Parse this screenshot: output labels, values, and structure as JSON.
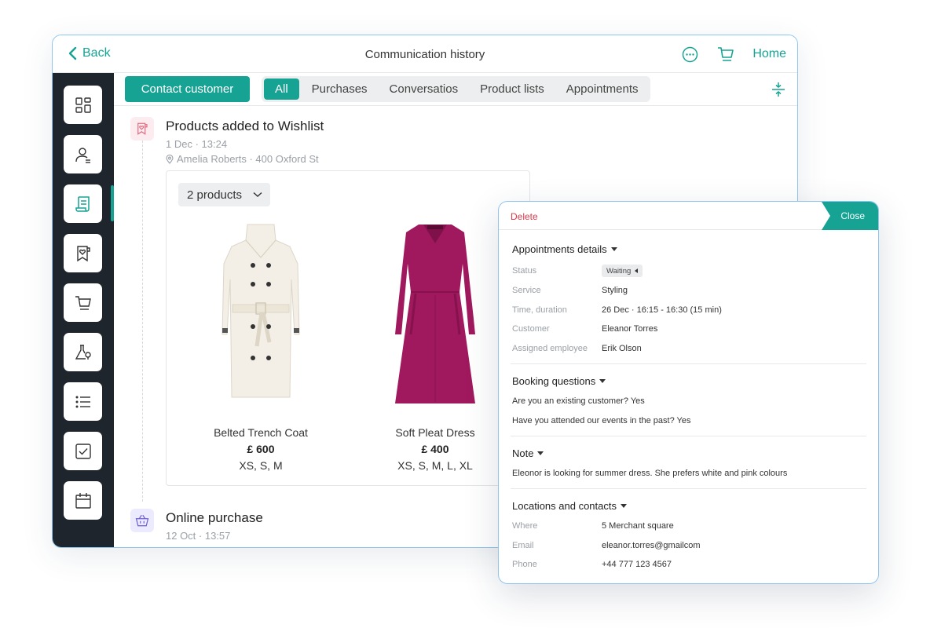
{
  "topbar": {
    "back_label": "Back",
    "title": "Communication history",
    "more_icon": "more-circle-icon",
    "cart_icon": "cart-icon",
    "home_label": "Home"
  },
  "sidebar": {
    "items": [
      {
        "icon": "dashboard-icon"
      },
      {
        "icon": "customer-profile-icon"
      },
      {
        "icon": "history-scroll-icon",
        "active": true
      },
      {
        "icon": "wishlist-bookmark-icon"
      },
      {
        "icon": "cart-icon"
      },
      {
        "icon": "lab-flask-icon"
      },
      {
        "icon": "list-icon"
      },
      {
        "icon": "checkbox-icon"
      },
      {
        "icon": "calendar-icon"
      }
    ]
  },
  "filters": {
    "contact_button": "Contact customer",
    "tabs": [
      "All",
      "Purchases",
      "Conversatios",
      "Product lists",
      "Appointments"
    ],
    "active_tab": "All"
  },
  "timeline": {
    "wishlist_event": {
      "title": "Products added to Wishlist",
      "date": "1 Dec · 13:24",
      "location": "Amelia Roberts · 400 Oxford St",
      "products_count": "2 products",
      "products": [
        {
          "name": "Belted Trench Coat",
          "price": "£ 600",
          "sizes": "XS, S, M"
        },
        {
          "name": "Soft Pleat Dress",
          "price": "£ 400",
          "sizes": "XS, S, M, L, XL"
        }
      ]
    },
    "purchase_event": {
      "title": "Online purchase",
      "date": "12 Oct · 13:57"
    }
  },
  "panel": {
    "delete_label": "Delete",
    "close_label": "Close",
    "appointment": {
      "heading": "Appointments details",
      "status_label": "Status",
      "status_value": "Waiting",
      "service_label": "Service",
      "service_value": "Styling",
      "time_label": "Time, duration",
      "time_value": "26 Dec · 16:15 - 16:30 (15 min)",
      "customer_label": "Customer",
      "customer_value": "Eleanor Torres",
      "employee_label": "Assigned employee",
      "employee_value": "Erik Olson"
    },
    "booking": {
      "heading": "Booking questions",
      "q1": "Are you an existing customer? Yes",
      "q2": "Have you attended our events in the past? Yes"
    },
    "note": {
      "heading": "Note",
      "text": "Eleonor is looking for summer dress. She prefers white and pink colours"
    },
    "locations": {
      "heading": "Locations and contacts",
      "where_label": "Where",
      "where_value": "5 Merchant square",
      "email_label": "Email",
      "email_value": "eleanor.torres@gmailcom",
      "phone_label": "Phone",
      "phone_value": "+44 777 123 4567"
    }
  },
  "colors": {
    "accent": "#16a394",
    "sidebar_bg": "#1e252c",
    "delete": "#e03a4a",
    "frame_border": "#8fc6ef",
    "coat": "#f3efe6",
    "dress": "#a0195e"
  }
}
